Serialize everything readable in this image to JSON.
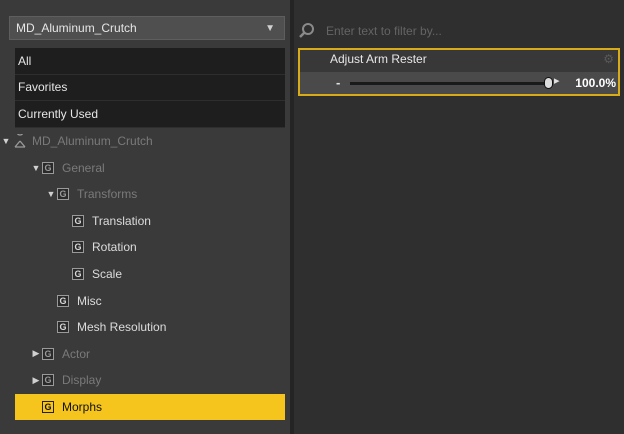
{
  "node_selector": {
    "value": "MD_Aluminum_Crutch",
    "icon": "dropdown-arrow-icon"
  },
  "categories": [
    {
      "label": "All"
    },
    {
      "label": "Favorites"
    },
    {
      "label": "Currently Used"
    }
  ],
  "tree": [
    {
      "label": "MD_Aluminum_Crutch",
      "depth": 0,
      "expander": "▼",
      "icon": "figure-icon",
      "disabled": true,
      "selected": false
    },
    {
      "label": "General",
      "depth": 1,
      "expander": "▼",
      "icon": "group-icon",
      "disabled": true,
      "selected": false
    },
    {
      "label": "Transforms",
      "depth": 2,
      "expander": "▼",
      "icon": "group-icon",
      "disabled": true,
      "selected": false
    },
    {
      "label": "Translation",
      "depth": 3,
      "expander": "",
      "icon": "group-icon",
      "disabled": false,
      "selected": false
    },
    {
      "label": "Rotation",
      "depth": 3,
      "expander": "",
      "icon": "group-icon",
      "disabled": false,
      "selected": false
    },
    {
      "label": "Scale",
      "depth": 3,
      "expander": "",
      "icon": "group-icon",
      "disabled": false,
      "selected": false
    },
    {
      "label": "Misc",
      "depth": 2,
      "expander": "",
      "icon": "group-icon",
      "disabled": false,
      "selected": false
    },
    {
      "label": "Mesh Resolution",
      "depth": 2,
      "expander": "",
      "icon": "group-icon",
      "disabled": false,
      "selected": false
    },
    {
      "label": "Actor",
      "depth": 1,
      "expander": "▶",
      "icon": "group-icon",
      "disabled": true,
      "selected": false
    },
    {
      "label": "Display",
      "depth": 1,
      "expander": "▶",
      "icon": "group-icon",
      "disabled": true,
      "selected": false
    },
    {
      "label": "Morphs",
      "depth": 1,
      "expander": "",
      "icon": "group-icon",
      "disabled": false,
      "selected": true
    }
  ],
  "group_icon_glyph": "G",
  "filter": {
    "placeholder": "Enter text to filter by...",
    "value": ""
  },
  "parameter": {
    "name": "Adjust Arm Rester",
    "value_text": "100.0%",
    "value_fraction": 1.0,
    "minus_label": "-",
    "plus_label": "▸"
  },
  "colors": {
    "selected": "#f5c51d",
    "highlight_border": "#d7ac18",
    "background": "#2b2b2b"
  }
}
